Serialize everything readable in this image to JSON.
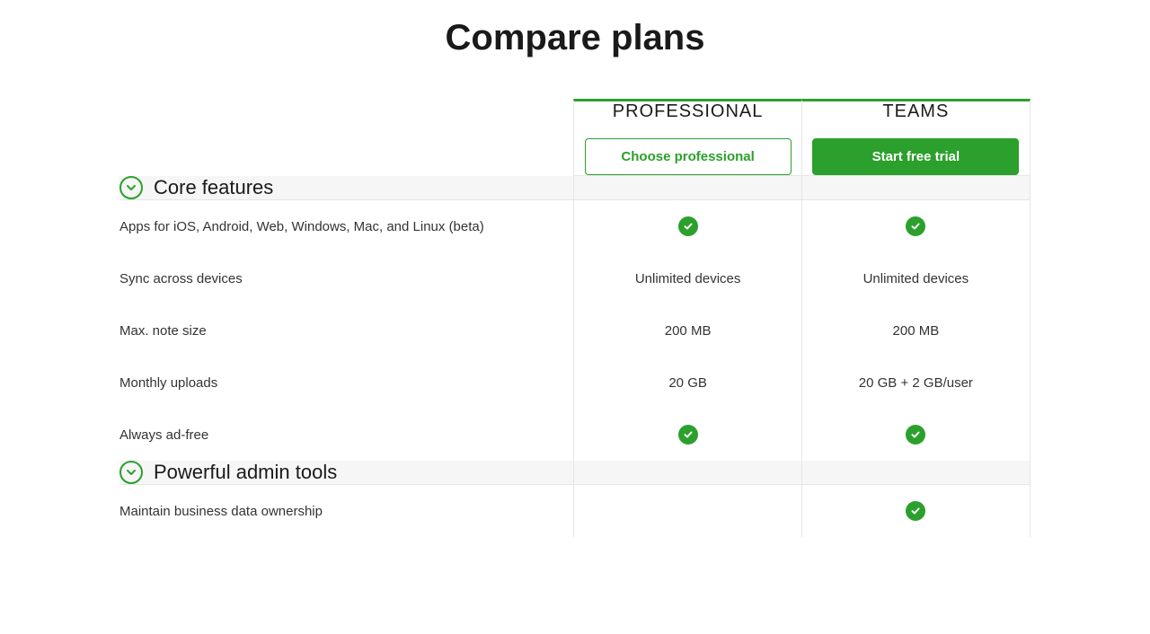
{
  "title": "Compare plans",
  "plans": [
    {
      "name": "PROFESSIONAL",
      "cta": "Choose professional",
      "cta_style": "outline"
    },
    {
      "name": "TEAMS",
      "cta": "Start free trial",
      "cta_style": "solid"
    }
  ],
  "sections": [
    {
      "title": "Core features",
      "rows": [
        {
          "label": "Apps for iOS, Android, Web, Windows, Mac, and Linux (beta)",
          "values": [
            "check",
            "check"
          ]
        },
        {
          "label": "Sync across devices",
          "values": [
            "Unlimited devices",
            "Unlimited devices"
          ]
        },
        {
          "label": "Max. note size",
          "values": [
            "200 MB",
            "200 MB"
          ]
        },
        {
          "label": "Monthly uploads",
          "values": [
            "20 GB",
            "20 GB + 2 GB/user"
          ]
        },
        {
          "label": "Always ad-free",
          "values": [
            "check",
            "check"
          ]
        }
      ]
    },
    {
      "title": "Powerful admin tools",
      "rows": [
        {
          "label": "Maintain business data ownership",
          "values": [
            "",
            "check"
          ]
        }
      ]
    }
  ]
}
